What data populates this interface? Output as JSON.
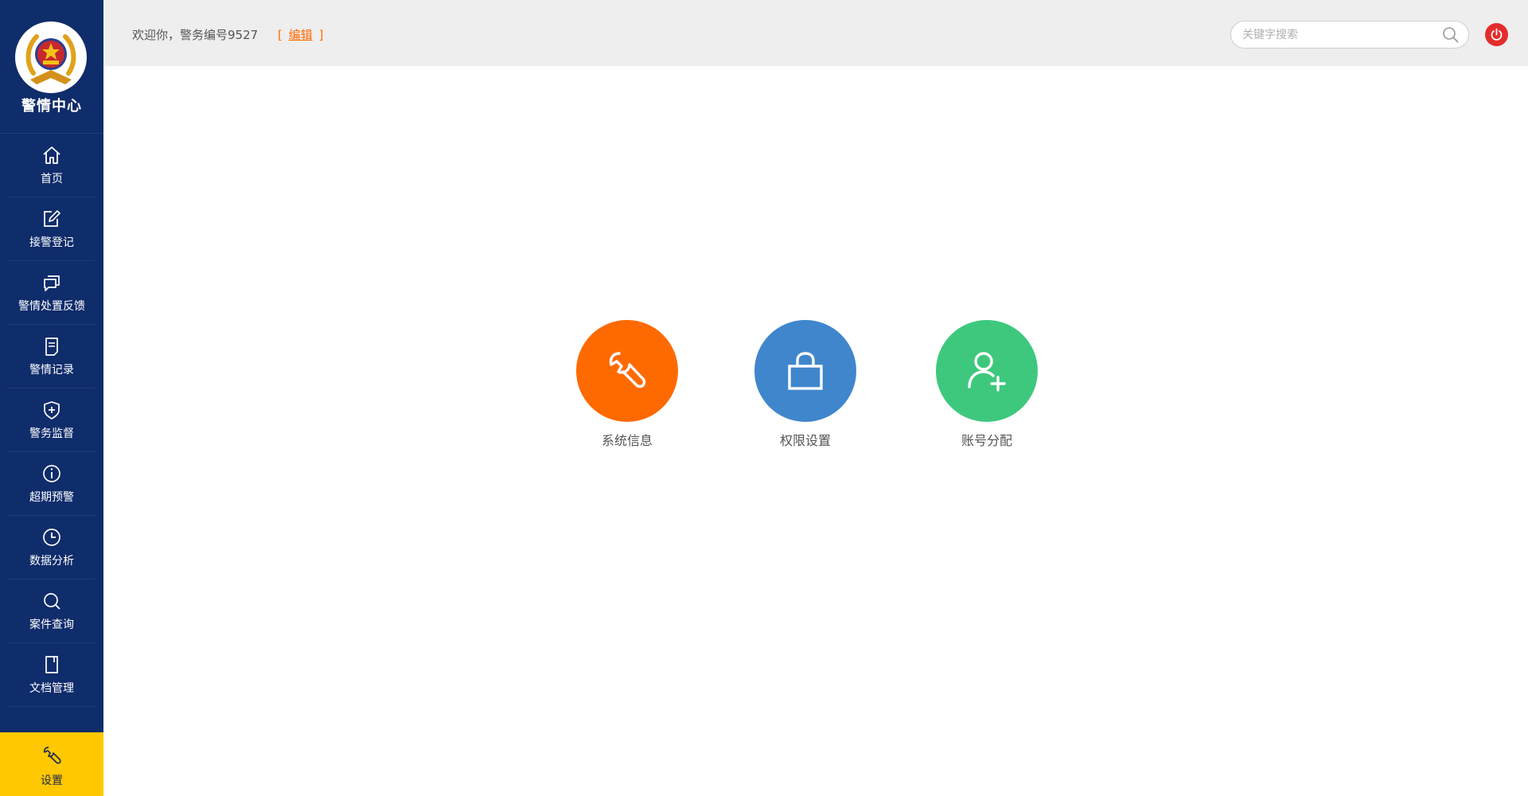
{
  "sidebar": {
    "brand_title": "警情中心",
    "items": [
      {
        "label": "首页",
        "icon": "home-icon"
      },
      {
        "label": "接警登记",
        "icon": "edit-icon"
      },
      {
        "label": "警情处置反馈",
        "icon": "chat-icon"
      },
      {
        "label": "警情记录",
        "icon": "document-icon"
      },
      {
        "label": "警务监督",
        "icon": "shield-icon"
      },
      {
        "label": "超期预警",
        "icon": "info-icon"
      },
      {
        "label": "数据分析",
        "icon": "clock-icon"
      },
      {
        "label": "案件查询",
        "icon": "search-icon"
      },
      {
        "label": "文档管理",
        "icon": "folder-icon"
      }
    ],
    "active": {
      "label": "设置",
      "icon": "wrench-icon"
    }
  },
  "header": {
    "welcome": "欢迎你，警务编号9527",
    "edit_open": "[",
    "edit_label": "编辑",
    "edit_close": "]",
    "search_placeholder": "关键字搜索"
  },
  "tiles": [
    {
      "label": "系统信息",
      "icon": "wrench-icon",
      "color": "#ff6a00"
    },
    {
      "label": "权限设置",
      "icon": "lock-icon",
      "color": "#3f86cc"
    },
    {
      "label": "账号分配",
      "icon": "add-user-icon",
      "color": "#3ec87e"
    }
  ],
  "colors": {
    "sidebar_bg": "#0f2c6b",
    "active_bg": "#ffc800",
    "header_bg": "#eeeeee",
    "accent": "#ff6a00",
    "power": "#e52c2c"
  }
}
